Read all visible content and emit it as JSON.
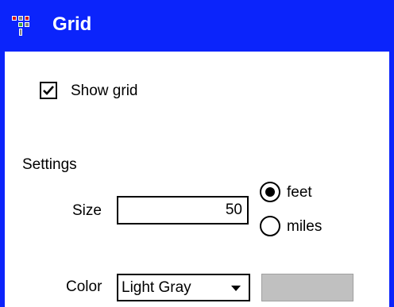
{
  "window": {
    "title": "Grid",
    "title_icon": "grid-app-icon",
    "accent_color": "#0b24fb"
  },
  "show_grid": {
    "label": "Show grid",
    "checked": true
  },
  "settings": {
    "heading": "Settings",
    "size": {
      "label": "Size",
      "value": "50"
    },
    "units": {
      "options": [
        {
          "label": "feet",
          "selected": true
        },
        {
          "label": "miles",
          "selected": false
        }
      ]
    },
    "color": {
      "label": "Color",
      "selected": "Light Gray",
      "swatch_color": "#c0c0c0"
    }
  }
}
